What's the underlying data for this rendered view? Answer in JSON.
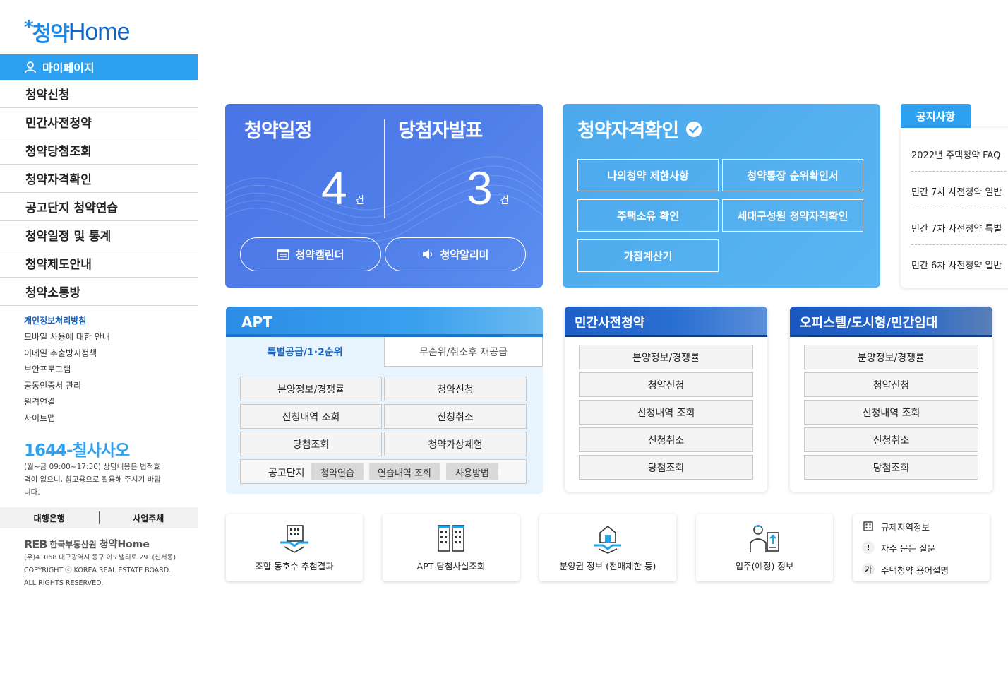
{
  "brand": {
    "logo_star": "*",
    "logo_ko": "청약",
    "logo_en": "Home"
  },
  "sidebar": {
    "mypage_label": "마이페이지",
    "nav": [
      "청약신청",
      "민간사전청약",
      "청약당첨조회",
      "청약자격확인",
      "공고단지 청약연습",
      "청약일정 및 통계",
      "청약제도안내",
      "청약소통방"
    ],
    "sublinks": [
      "개인정보처리방침",
      "모바일 사용에 대한 안내",
      "이메일 추출방지정책",
      "보안프로그램",
      "공동인증서 관리",
      "원격연결",
      "사이트맵"
    ],
    "phone": "1644-칠사사오",
    "phone_note": "(월~금 09:00~17:30) 상담내용은 법적효력이 없으니, 참고용으로 활용해 주시기 바랍니다.",
    "banks": {
      "left": "대행은행",
      "right": "사업주체"
    },
    "reb": {
      "logo": "REB",
      "name": "한국부동산원",
      "home": "청약Home"
    },
    "copyright": [
      "(우)41068 대구광역시 동구 이노밸리로 291(신서동)",
      "COPYRIGHT ⓒ KOREA REAL ESTATE BOARD.",
      "ALL RIGHTS RESERVED."
    ]
  },
  "schedule": {
    "left_title": "청약일정",
    "left_count": "4",
    "left_unit": "건",
    "right_title": "당첨자발표",
    "right_count": "3",
    "right_unit": "건",
    "calendar_btn": "청약캘린더",
    "alarm_btn": "청약알리미"
  },
  "eligibility": {
    "title": "청약자격확인",
    "buttons": [
      "나의청약 제한사항",
      "청약통장 순위확인서",
      "주택소유 확인",
      "세대구성원 청약자격확인",
      "가점계산기"
    ]
  },
  "notice": {
    "tab": "공지사항",
    "items": [
      "2022년 주택청약 FAQ",
      "민간 7차 사전청약 일반",
      "민간 7차 사전청약 특별",
      "민간 6차 사전청약 일반"
    ]
  },
  "apt": {
    "title": "APT",
    "tab_active": "특별공급/1·2순위",
    "tab_inactive": "무순위/취소후 재공급",
    "buttons": [
      "분양정보/경쟁률",
      "청약신청",
      "신청내역 조회",
      "신청취소",
      "당첨조회",
      "청약가상체험"
    ],
    "practice_label": "공고단지",
    "practice_chips": [
      "청약연습",
      "연습내역 조회",
      "사용방법"
    ]
  },
  "private_pre": {
    "title": "민간사전청약",
    "buttons": [
      "분양정보/경쟁률",
      "청약신청",
      "신청내역 조회",
      "신청취소",
      "당첨조회"
    ]
  },
  "officetel": {
    "title": "오피스텔/도시형/민간임대",
    "buttons": [
      "분양정보/경쟁률",
      "청약신청",
      "신청내역 조회",
      "신청취소",
      "당첨조회"
    ]
  },
  "tiles": [
    "조합 동호수 추첨결과",
    "APT 당첨사실조회",
    "분양권 정보 (전매제한 등)",
    "입주(예정) 정보"
  ],
  "quick_links": {
    "items": [
      "규제지역정보",
      "자주 묻는 질문",
      "주택청약 용어설명"
    ],
    "faq_glyph": "!",
    "glossary_glyph": "가"
  },
  "colors": {
    "accent": "#2ea0f0",
    "schedule_bg": "#4f7ee8",
    "eligibility_bg": "#5ab6f2",
    "dark_blue": "#1565c0"
  }
}
